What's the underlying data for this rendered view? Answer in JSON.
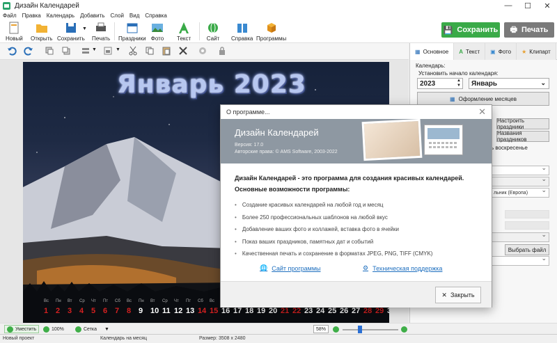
{
  "window": {
    "title": "Дизайн Календарей"
  },
  "menu": [
    "Файл",
    "Правка",
    "Календарь",
    "Добавить",
    "Слой",
    "Вид",
    "Справка"
  ],
  "toolbar": {
    "new": "Новый",
    "open": "Открыть",
    "save": "Сохранить",
    "print": "Печать",
    "holidays": "Праздники",
    "photo": "Фото",
    "text": "Текст",
    "site": "Сайт",
    "help": "Справка",
    "programs": "Программы",
    "save_main": "Сохранить",
    "print_main": "Печать"
  },
  "calendar": {
    "title": "Январь 2023",
    "dow": [
      "Вс",
      "Пн",
      "Вт",
      "Ср",
      "Чт",
      "Пт",
      "Сб",
      "Вс",
      "Пн",
      "Вт",
      "Ср",
      "Чт",
      "Пт",
      "Сб",
      "Вс",
      "Пн",
      "Вт",
      "Ср",
      "Чт",
      "Пт",
      "Сб",
      "Вс",
      "Пн",
      "Вт",
      "Ср",
      "Чт",
      "Пт",
      "Сб",
      "Вс",
      "Пн",
      "Вт"
    ],
    "days": [
      1,
      2,
      3,
      4,
      5,
      6,
      7,
      8,
      9,
      10,
      11,
      12,
      13,
      14,
      15,
      16,
      17,
      18,
      19,
      20,
      21,
      22,
      23,
      24,
      25,
      26,
      27,
      28,
      29,
      30,
      31
    ],
    "red_days": [
      1,
      2,
      3,
      4,
      5,
      6,
      7,
      8,
      14,
      15,
      21,
      22,
      28,
      29
    ]
  },
  "panel": {
    "tabs": [
      "Основное",
      "Текст",
      "Фото",
      "Клипарт"
    ],
    "calendar_label": "Календарь:",
    "start_label": "Установить начало календаря:",
    "year": "2023",
    "month": "Январь",
    "months_design": "Оформление месяцев",
    "setup_holidays": "Настроить праздники",
    "holiday_names": "Названия праздников",
    "sunday_text": "ь воскресенье",
    "week_start": "льник (Европа)",
    "choose_file": "Выбрать файл"
  },
  "dialog": {
    "title": "О программе...",
    "app_name": "Дизайн Календарей",
    "version": "Версия: 17.0",
    "copyright": "Авторские права: © AMS Software, 2003-2022",
    "intro": "Дизайн Календарей - это программа для создания красивых календарей.",
    "features_title": "Основные возможности программы:",
    "features": [
      "Создание красивых календарей на любой год и месяц",
      "Более 250 профессиональных шаблонов на любой вкус",
      "Добавление ваших фото и коллажей, вставка фото в ячейки",
      "Показ ваших праздников, памятных дат и событий",
      "Качественная печать и сохранение в форматах JPEG, PNG, TIFF (CMYK)"
    ],
    "site_link": "Сайт программы",
    "support_link": "Техническая поддержка",
    "close": "Закрыть"
  },
  "bottombar": {
    "fit": "Уместить",
    "zoom100": "100%",
    "grid": "Сетка",
    "zoom": "58%"
  },
  "status": {
    "project": "Новый проект",
    "type": "Календарь на месяц",
    "size": "Размер: 3508 x 2480"
  }
}
